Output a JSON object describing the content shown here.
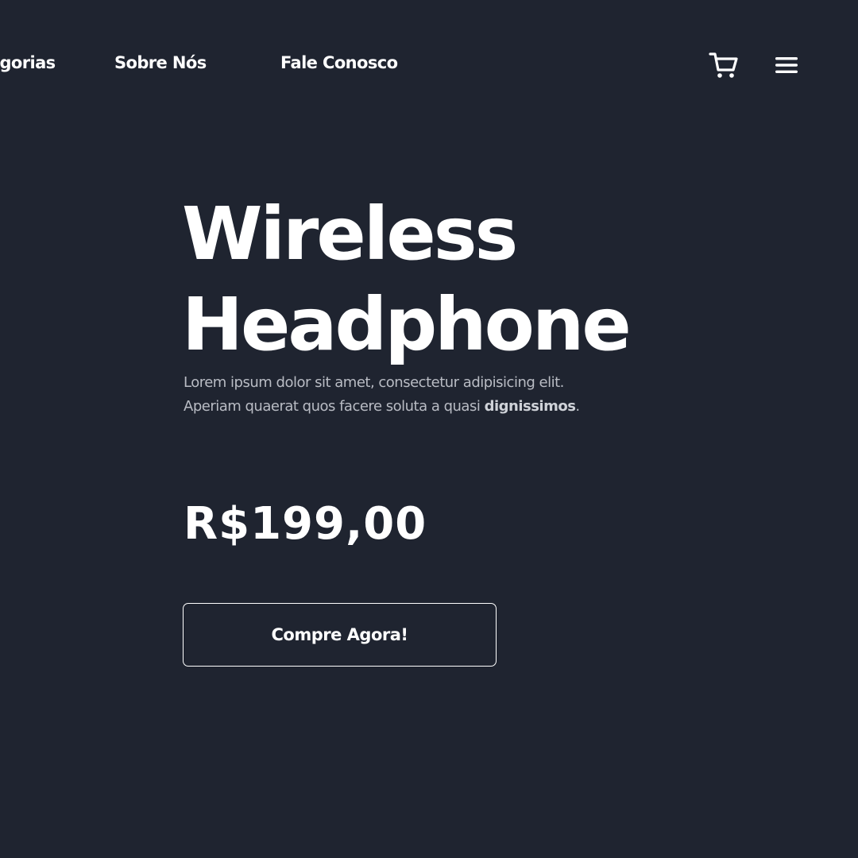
{
  "nav": {
    "links": [
      {
        "label": "Categorias"
      },
      {
        "label": "Sobre Nós"
      },
      {
        "label": "Fale Conosco"
      }
    ],
    "icons": {
      "cart": "cart-icon",
      "menu": "hamburger-menu-icon"
    }
  },
  "hero": {
    "title_line1": "Wireless",
    "title_line2": "Headphone",
    "description_line1": "Lorem ipsum dolor sit amet, consectetur adipisicing elit.",
    "description_line2": "Aperiam quaerat quos facere soluta a quasi ",
    "description_bold": "dignissimos",
    "description_end": ".",
    "price": "R$199,00",
    "cta_label": "Compre Agora!"
  },
  "colors": {
    "background": "#1f2430",
    "text": "#ffffff",
    "muted_text": "#b9bcc4"
  }
}
